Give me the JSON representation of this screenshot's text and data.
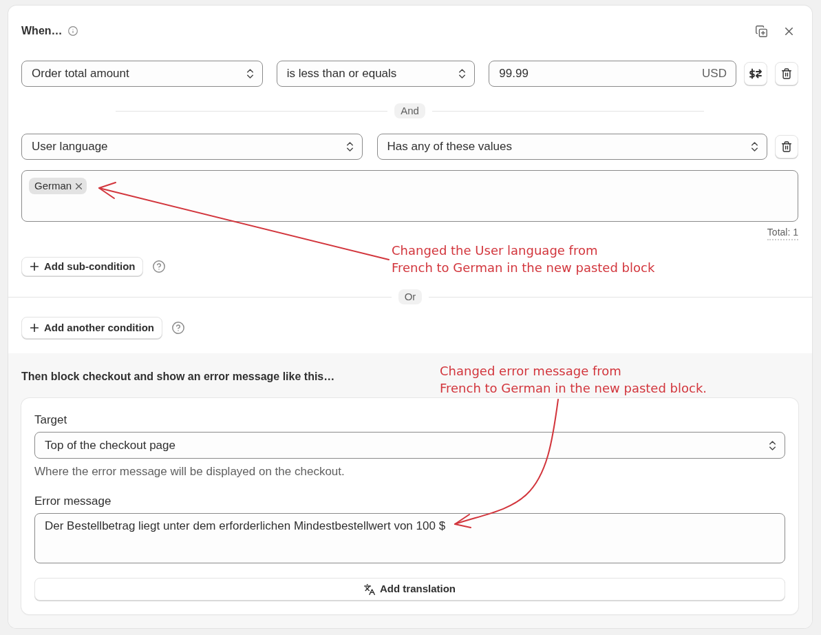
{
  "title": "When…",
  "conditions": [
    {
      "kind": "amount",
      "field": "Order total amount",
      "operator": "is less than or equals",
      "value": "99.99",
      "currency": "USD"
    },
    {
      "kind": "list",
      "joiner": "And",
      "field": "User language",
      "operator": "Has any of these values",
      "tags": [
        "German"
      ],
      "total": "Total: 1"
    }
  ],
  "add_sub_condition": "Add sub-condition",
  "or_label": "Or",
  "add_condition": "Add another condition",
  "action": {
    "title": "Then block checkout and show an error message like this…",
    "target_label": "Target",
    "target_value": "Top of the checkout page",
    "target_help": "Where the error message will be displayed on the checkout.",
    "message_label": "Error message",
    "message_value": "Der Bestellbetrag liegt unter dem erforderlichen Mindestbestellwert von 100 $",
    "add_translation": "Add translation"
  },
  "annotations": [
    {
      "lines": [
        "Changed the User language from",
        "French to German in the new pasted block"
      ]
    },
    {
      "lines": [
        "Changed error message from",
        "French to German in the new pasted block."
      ]
    }
  ]
}
